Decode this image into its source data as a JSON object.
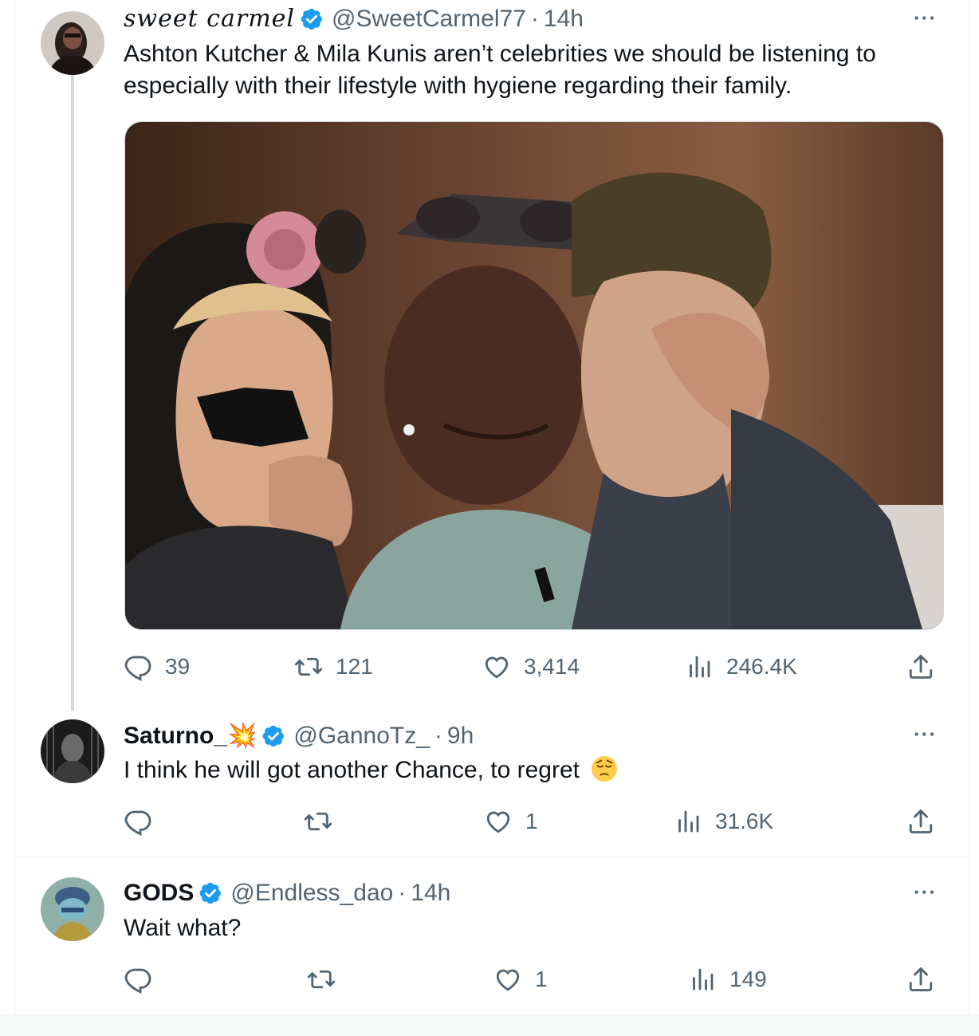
{
  "tweets": [
    {
      "name": "sweet carmel",
      "handle": "@SweetCarmel77",
      "dot": "·",
      "time": "14h",
      "text": "Ashton Kutcher & Mila Kunis aren’t celebrities we should be listening to especially with their lifestyle with hygiene regarding their family.",
      "media_description_icon": "photo",
      "replies": "39",
      "retweets": "121",
      "likes": "3,414",
      "views": "246.4K"
    },
    {
      "name": "Saturno_💥",
      "handle": "@GannoTz_",
      "dot": "·",
      "time": "9h",
      "text": "I think he will got another Chance, to regret",
      "replies": "",
      "retweets": "",
      "likes": "1",
      "views": "31.6K"
    },
    {
      "name": "GODS",
      "handle": "@Endless_dao",
      "dot": "·",
      "time": "14h",
      "text": "Wait what?",
      "replies": "",
      "retweets": "",
      "likes": "1",
      "views": "149"
    }
  ],
  "more_label": "···",
  "colors": {
    "text": "#0f1419",
    "secondary": "#536471",
    "verified": "#1d9bf0",
    "border": "#eff3f4"
  },
  "icons": [
    "reply-icon",
    "retweet-icon",
    "like-icon",
    "views-icon",
    "share-icon",
    "verified-badge-icon",
    "more-icon"
  ]
}
